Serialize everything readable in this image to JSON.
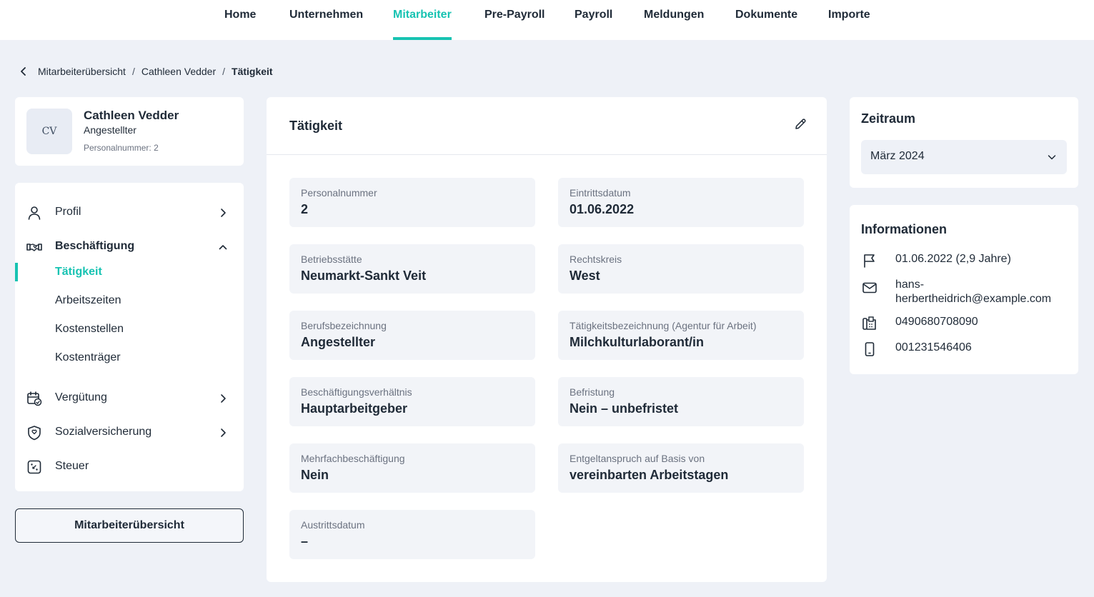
{
  "nav": {
    "items": [
      {
        "label": "Home",
        "active": false
      },
      {
        "label": "Unternehmen",
        "active": false
      },
      {
        "label": "Mitarbeiter",
        "active": true
      },
      {
        "label": "Pre-Payroll",
        "active": false
      },
      {
        "label": "Payroll",
        "active": false
      },
      {
        "label": "Meldungen",
        "active": false
      },
      {
        "label": "Dokumente",
        "active": false
      },
      {
        "label": "Importe",
        "active": false
      }
    ]
  },
  "breadcrumb": {
    "items": [
      "Mitarbeiterübersicht",
      "Cathleen Vedder",
      "Tätigkeit"
    ],
    "separator": "/"
  },
  "employee": {
    "initials": "CV",
    "name": "Cathleen Vedder",
    "role": "Angestellter",
    "personnel_label": "Personalnummer:",
    "personnel_number": "2"
  },
  "menu": {
    "profil": "Profil",
    "beschaeftigung": "Beschäftigung",
    "sub": [
      "Tätigkeit",
      "Arbeitszeiten",
      "Kostenstellen",
      "Kostenträger"
    ],
    "verguetung": "Vergütung",
    "sozialversicherung": "Sozialversicherung",
    "steuer": "Steuer"
  },
  "overview_button": "Mitarbeiterübersicht",
  "main": {
    "title": "Tätigkeit",
    "fields": [
      {
        "label": "Personalnummer",
        "value": "2"
      },
      {
        "label": "Eintrittsdatum",
        "value": "01.06.2022"
      },
      {
        "label": "Betriebsstätte",
        "value": "Neumarkt-Sankt Veit"
      },
      {
        "label": "Rechtskreis",
        "value": "West"
      },
      {
        "label": "Berufsbezeichnung",
        "value": "Angestellter"
      },
      {
        "label": "Tätigkeitsbezeichnung (Agentur für Arbeit)",
        "value": "Milchkulturlaborant/in"
      },
      {
        "label": "Beschäftigungsverhältnis",
        "value": "Hauptarbeitgeber"
      },
      {
        "label": "Befristung",
        "value": "Nein – unbefristet"
      },
      {
        "label": "Mehrfachbeschäftigung",
        "value": "Nein"
      },
      {
        "label": "Entgeltanspruch auf Basis von",
        "value": "vereinbarten Arbeitstagen"
      },
      {
        "label": "Austrittsdatum",
        "value": "–"
      }
    ]
  },
  "zeitraum": {
    "title": "Zeitraum",
    "selected": "März 2024"
  },
  "info": {
    "title": "Informationen",
    "entry": "01.06.2022 (2,9 Jahre)",
    "email_line1": "hans-",
    "email_line2": "herbertheidrich@example.com",
    "phone": "0490680708090",
    "mobile": "001231546406"
  },
  "colors": {
    "accent": "#17c3b2",
    "background": "#eef1f7",
    "text": "#1f2a37"
  }
}
